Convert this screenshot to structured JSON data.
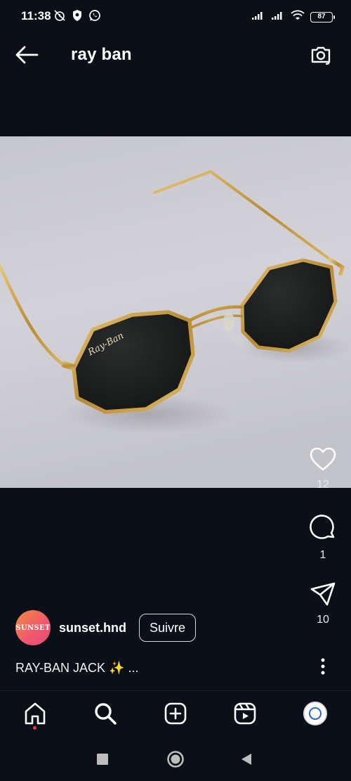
{
  "status_bar": {
    "time": "11:38",
    "battery": "87",
    "icons": [
      "alarm-off-icon",
      "shield-icon",
      "whatsapp-icon",
      "signal-icon",
      "signal-icon",
      "wifi-icon",
      "battery-icon"
    ]
  },
  "header": {
    "title": "ray ban",
    "back_icon": "arrow-left-icon",
    "camera_icon": "camera-icon"
  },
  "post": {
    "image": "sunglasses-photo",
    "lens_brand_mark": "Ray-Ban",
    "likes": "12",
    "comments": "1",
    "shares": "10"
  },
  "author": {
    "avatar_text": "SUNSET",
    "username": "sunset.hnd",
    "follow_label": "Suivre"
  },
  "caption": "RAY-BAN JACK ✨ ...",
  "bottom_nav": {
    "items": [
      "home-icon",
      "search-icon",
      "create-icon",
      "reels-icon",
      "profile-avatar"
    ]
  },
  "system_nav": [
    "square-recent-icon",
    "circle-home-icon",
    "triangle-back-icon"
  ],
  "colors": {
    "background": "#0b0f17",
    "photo_bg": "#c8c8cf",
    "gold": "#c9a24a",
    "notification_dot": "#ff3040"
  }
}
